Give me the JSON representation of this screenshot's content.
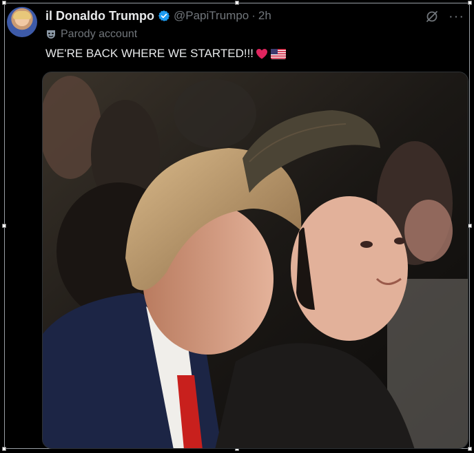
{
  "tweet": {
    "display_name": "il Donaldo Trumpo",
    "handle": "@PapiTrumpo",
    "separator": "·",
    "time": "2h",
    "parody_label": "Parody account",
    "text": "WE'RE BACK WHERE WE STARTED!!!",
    "more_label": "···"
  },
  "icons": {
    "verified": "verified-badge-icon",
    "parody": "parody-mask-icon",
    "grok": "grok-icon",
    "more": "more-options-icon",
    "heart": "red-heart-emoji",
    "flag": "us-flag-emoji"
  },
  "colors": {
    "background": "#000000",
    "text_primary": "#e7e9ea",
    "text_secondary": "#71767b",
    "verified_blue": "#1d9bf0",
    "heart_red": "#e0245e"
  }
}
